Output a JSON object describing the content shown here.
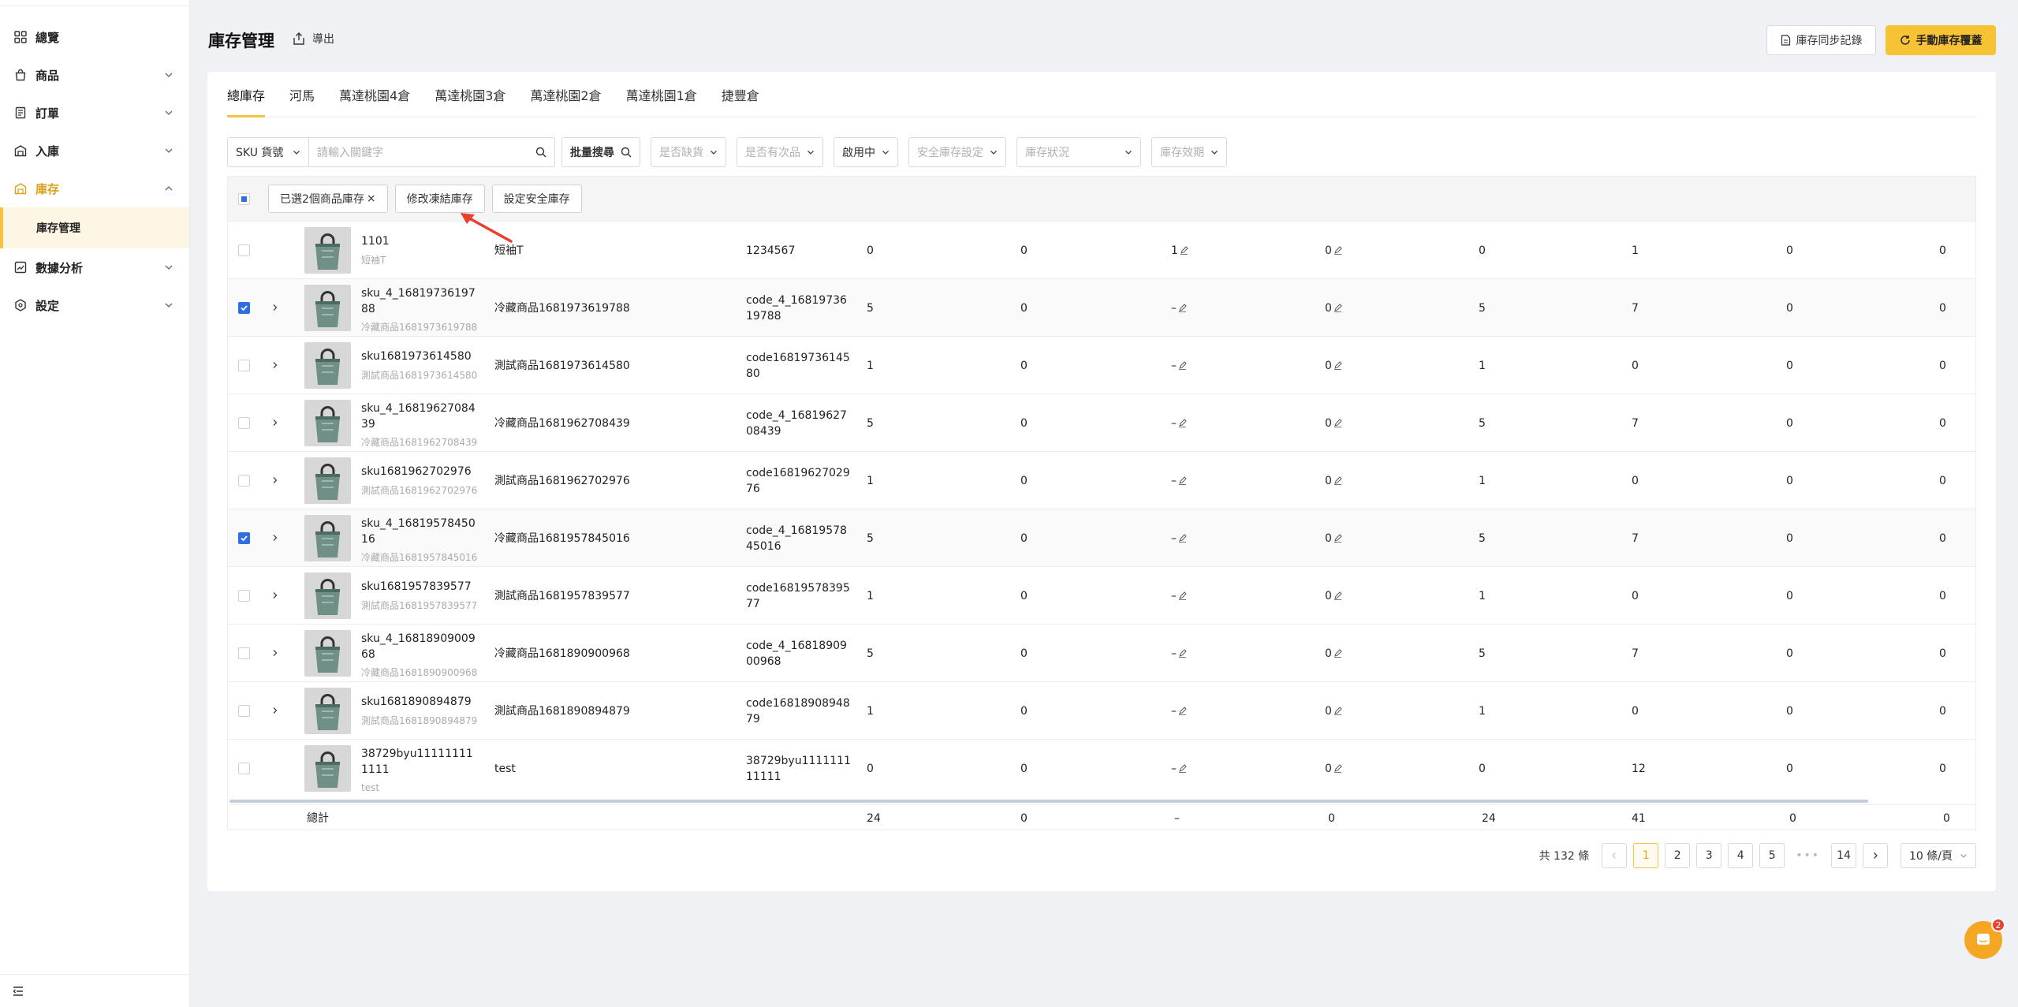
{
  "sidebar": {
    "items": [
      {
        "label": "總覽",
        "icon": "grid-icon"
      },
      {
        "label": "商品",
        "icon": "bag-icon"
      },
      {
        "label": "訂單",
        "icon": "receipt-icon"
      },
      {
        "label": "入庫",
        "icon": "inbound-icon"
      },
      {
        "label": "庫存",
        "icon": "warehouse-icon"
      },
      {
        "label": "數據分析",
        "icon": "chart-icon"
      },
      {
        "label": "設定",
        "icon": "hexagon-icon"
      }
    ],
    "sub_item": "庫存管理"
  },
  "header": {
    "title": "庫存管理",
    "export_label": "導出",
    "sync_label": "庫存同步記錄",
    "override_label": "手動庫存覆蓋"
  },
  "tabs": [
    "總庫存",
    "河馬",
    "萬達桃園4倉",
    "萬達桃園3倉",
    "萬達桃園2倉",
    "萬達桃園1倉",
    "捷豐倉"
  ],
  "filters": {
    "sku_select": "SKU 貨號",
    "search_placeholder": "請輸入關鍵字",
    "batch_search": "批量搜尋",
    "out_of_stock": "是否缺貨",
    "defective": "是否有次品",
    "status": "啟用中",
    "safety_setting": "安全庫存設定",
    "stock_status": "庫存狀況",
    "expiry": "庫存效期"
  },
  "table": {
    "selected_label": "已選2個商品庫存",
    "modify_frozen": "修改凍結庫存",
    "set_safety": "設定安全庫存",
    "rows": [
      {
        "sku": "1101",
        "sub": "短袖T",
        "name": "短袖T",
        "code": "1234567",
        "c1": "0",
        "c2": "0",
        "c3": "1",
        "c4": "0",
        "c5": "0",
        "c6": "1",
        "c7": "0",
        "c8": "0",
        "checked": false,
        "expandable": false
      },
      {
        "sku": "sku_4_1681973619788",
        "sub": "冷藏商品1681973619788",
        "name": "冷藏商品1681973619788",
        "code": "code_4_1681973619788",
        "c1": "5",
        "c2": "0",
        "c3": "–",
        "c4": "0",
        "c5": "5",
        "c6": "7",
        "c7": "0",
        "c8": "0",
        "checked": true,
        "expandable": true
      },
      {
        "sku": "sku1681973614580",
        "sub": "測試商品1681973614580",
        "name": "測試商品1681973614580",
        "code": "code1681973614580",
        "c1": "1",
        "c2": "0",
        "c3": "–",
        "c4": "0",
        "c5": "1",
        "c6": "0",
        "c7": "0",
        "c8": "0",
        "checked": false,
        "expandable": true
      },
      {
        "sku": "sku_4_1681962708439",
        "sub": "冷藏商品1681962708439",
        "name": "冷藏商品1681962708439",
        "code": "code_4_1681962708439",
        "c1": "5",
        "c2": "0",
        "c3": "–",
        "c4": "0",
        "c5": "5",
        "c6": "7",
        "c7": "0",
        "c8": "0",
        "checked": false,
        "expandable": true
      },
      {
        "sku": "sku1681962702976",
        "sub": "測試商品1681962702976",
        "name": "測試商品1681962702976",
        "code": "code1681962702976",
        "c1": "1",
        "c2": "0",
        "c3": "–",
        "c4": "0",
        "c5": "1",
        "c6": "0",
        "c7": "0",
        "c8": "0",
        "checked": false,
        "expandable": true
      },
      {
        "sku": "sku_4_1681957845016",
        "sub": "冷藏商品1681957845016",
        "name": "冷藏商品1681957845016",
        "code": "code_4_1681957845016",
        "c1": "5",
        "c2": "0",
        "c3": "–",
        "c4": "0",
        "c5": "5",
        "c6": "7",
        "c7": "0",
        "c8": "0",
        "checked": true,
        "expandable": true
      },
      {
        "sku": "sku1681957839577",
        "sub": "測試商品1681957839577",
        "name": "測試商品1681957839577",
        "code": "code1681957839577",
        "c1": "1",
        "c2": "0",
        "c3": "–",
        "c4": "0",
        "c5": "1",
        "c6": "0",
        "c7": "0",
        "c8": "0",
        "checked": false,
        "expandable": true
      },
      {
        "sku": "sku_4_1681890900968",
        "sub": "冷藏商品1681890900968",
        "name": "冷藏商品1681890900968",
        "code": "code_4_1681890900968",
        "c1": "5",
        "c2": "0",
        "c3": "–",
        "c4": "0",
        "c5": "5",
        "c6": "7",
        "c7": "0",
        "c8": "0",
        "checked": false,
        "expandable": true
      },
      {
        "sku": "sku1681890894879",
        "sub": "測試商品1681890894879",
        "name": "測試商品1681890894879",
        "code": "code1681890894879",
        "c1": "1",
        "c2": "0",
        "c3": "–",
        "c4": "0",
        "c5": "1",
        "c6": "0",
        "c7": "0",
        "c8": "0",
        "checked": false,
        "expandable": true
      },
      {
        "sku": "38729byu111111111111",
        "sub": "test",
        "name": "test",
        "code": "38729byu111111111111",
        "c1": "0",
        "c2": "0",
        "c3": "–",
        "c4": "0",
        "c5": "0",
        "c6": "12",
        "c7": "0",
        "c8": "0",
        "checked": false,
        "expandable": false
      }
    ],
    "total": {
      "label": "總計",
      "c1": "24",
      "c2": "0",
      "c3": "–",
      "c4": "0",
      "c5": "24",
      "c6": "41",
      "c7": "0",
      "c8": "0"
    }
  },
  "pagination": {
    "total": "共 132 條",
    "pages": [
      "1",
      "2",
      "3",
      "4",
      "5"
    ],
    "dots": "•••",
    "last": "14",
    "page_size": "10 條/頁"
  },
  "chat": {
    "badge": "2"
  },
  "colors": {
    "accent": "#f7c234",
    "checkbox": "#2f6ee0",
    "annotation_arrow": "#e8412e"
  }
}
